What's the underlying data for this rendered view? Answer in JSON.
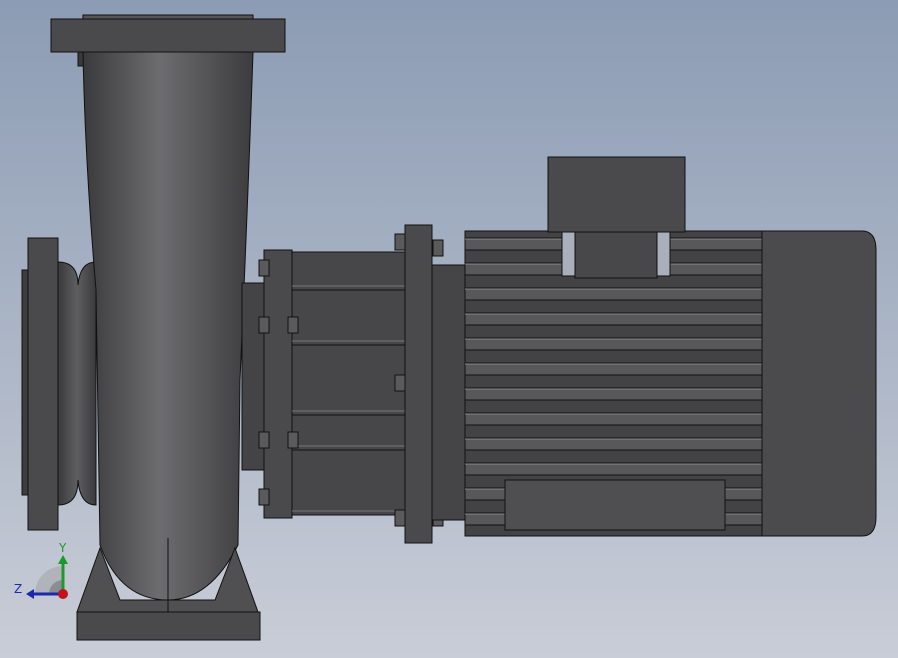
{
  "viewport": {
    "background_top": "#8c9cb4",
    "background_bottom": "#c9cdd7",
    "model_color": "#4d4d4f"
  },
  "triad": {
    "y_label": "Y",
    "z_label": "Z",
    "y_color": "#1a9a2a",
    "z_color": "#1a2aa8",
    "x_color": "#c0141a"
  }
}
